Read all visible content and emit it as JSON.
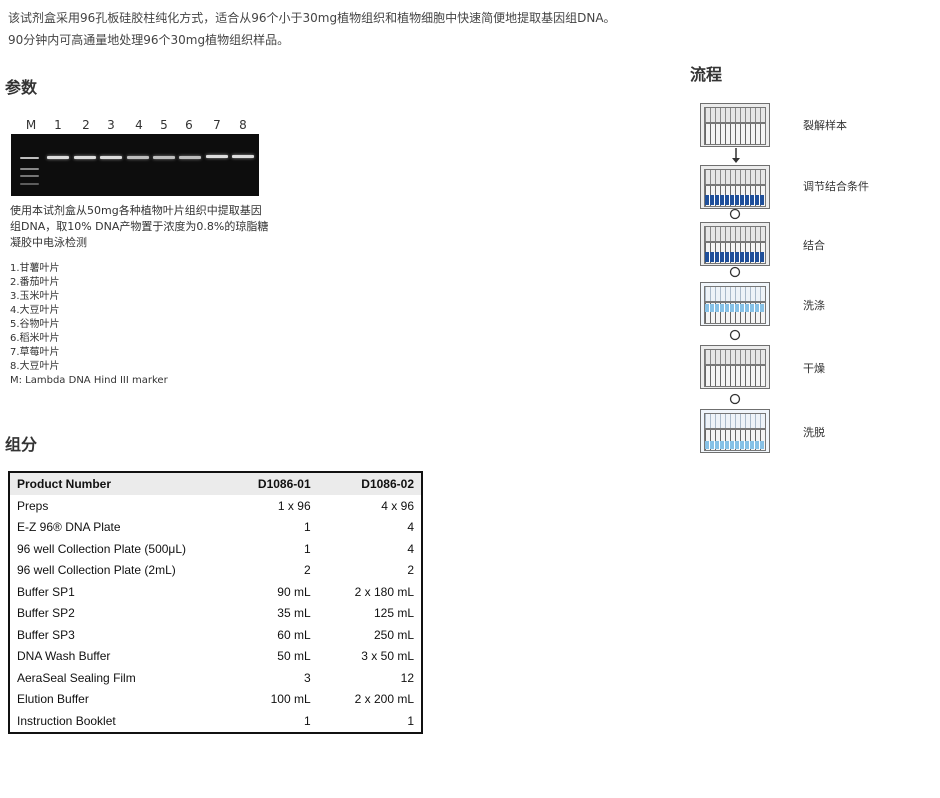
{
  "intro": {
    "line1": "该试剂盒采用96孔板硅胶柱纯化方式，适合从96个小于30mg植物组织和植物细胞中快速简便地提取基因组DNA。",
    "line2": "90分钟内可高通量地处理96个30mg植物组织样品。"
  },
  "params": {
    "heading": "参数",
    "lanes": [
      "M",
      "1",
      "2",
      "3",
      "4",
      "5",
      "6",
      "7",
      "8"
    ],
    "caption": "使用本试剂盒从50mg各种植物叶片组织中提取基因组DNA，取10% DNA产物置于浓度为0.8%的琼脂糖凝胶中电泳检测",
    "samples": [
      "1.甘薯叶片",
      "2.番茄叶片",
      "3.玉米叶片",
      "4.大豆叶片",
      "5.谷物叶片",
      "6.稻米叶片",
      "7.草莓叶片",
      "8.大豆叶片",
      "M: Lambda DNA Hind III marker"
    ]
  },
  "components": {
    "heading": "组分",
    "columns": [
      "Product Number",
      "D1086-01",
      "D1086-02"
    ],
    "rows": [
      [
        "Preps",
        "1 x 96",
        "4 x 96"
      ],
      [
        "E-Z 96® DNA Plate",
        "1",
        "4"
      ],
      [
        "96 well Collection Plate (500μL)",
        "1",
        "4"
      ],
      [
        "96 well Collection Plate (2mL)",
        "2",
        "2"
      ],
      [
        "Buffer SP1",
        "90 mL",
        "2 x 180 mL"
      ],
      [
        "Buffer SP2",
        "35 mL",
        "125 mL"
      ],
      [
        "Buffer SP3",
        "60 mL",
        "250 mL"
      ],
      [
        "DNA Wash Buffer",
        "50 mL",
        "3 x 50 mL"
      ],
      [
        "AeraSeal Sealing Film",
        "3",
        "12"
      ],
      [
        "Elution Buffer",
        "100 mL",
        "2 x 200 mL"
      ],
      [
        "Instruction Booklet",
        "1",
        "1"
      ]
    ]
  },
  "flow": {
    "heading": "流程",
    "steps": [
      "裂解样本",
      "调节结合条件",
      "结合",
      "洗涤",
      "干燥",
      "洗脱"
    ]
  }
}
